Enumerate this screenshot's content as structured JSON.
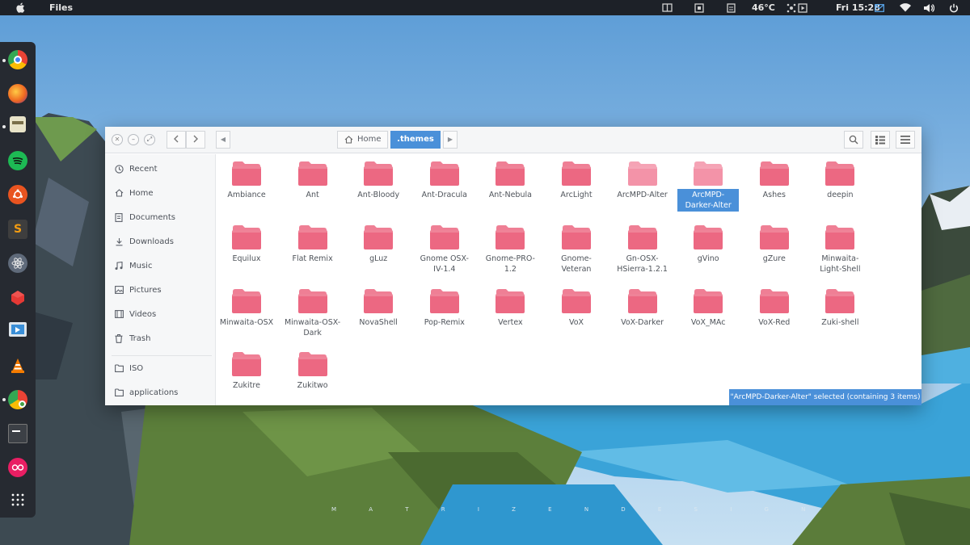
{
  "topbar": {
    "app_menu": "Files",
    "temperature": "46°C",
    "clock": "Fri 15:28"
  },
  "dock": {
    "items": [
      {
        "name": "chrome",
        "color": "#e9443a"
      },
      {
        "name": "firefox",
        "color": "#ef6a21"
      },
      {
        "name": "files",
        "color": "#e8e3c8"
      },
      {
        "name": "spotify",
        "color": "#1db954"
      },
      {
        "name": "ubuntu-software",
        "color": "#e95420"
      },
      {
        "name": "sublime-text",
        "color": "#f39c12"
      },
      {
        "name": "atom",
        "color": "#5f6a7a"
      },
      {
        "name": "ruby",
        "color": "#e53935"
      },
      {
        "name": "video-player",
        "color": "#3a8fd8"
      },
      {
        "name": "vlc",
        "color": "#f57c00"
      },
      {
        "name": "chrome-updater",
        "color": "#43a047"
      },
      {
        "name": "terminal",
        "color": "#3c4046"
      },
      {
        "name": "flickr",
        "color": "#e91e63"
      },
      {
        "name": "app-grid",
        "color": "#ffffff"
      }
    ]
  },
  "window": {
    "breadcrumb": {
      "home": "Home",
      "current": ".themes"
    },
    "sidebar": [
      {
        "label": "Recent",
        "icon": "clock-icon"
      },
      {
        "label": "Home",
        "icon": "home-icon"
      },
      {
        "label": "Documents",
        "icon": "document-icon"
      },
      {
        "label": "Downloads",
        "icon": "download-icon"
      },
      {
        "label": "Music",
        "icon": "music-icon"
      },
      {
        "label": "Pictures",
        "icon": "picture-icon"
      },
      {
        "label": "Videos",
        "icon": "video-icon"
      },
      {
        "label": "Trash",
        "icon": "trash-icon"
      },
      {
        "label": "ISO",
        "icon": "folder-icon"
      },
      {
        "label": "applications",
        "icon": "folder-icon"
      }
    ],
    "files": [
      "Ambiance",
      "Ant",
      "Ant-Bloody",
      "Ant-Dracula",
      "Ant-Nebula",
      "ArcLight",
      "ArcMPD-Alter",
      "ArcMPD-Darker-Alter",
      "Ashes",
      "deepin",
      "Equilux",
      "Flat Remix",
      "gLuz",
      "Gnome OSX-IV-1.4",
      "Gnome-PRO-1.2",
      "Gnome-Veteran",
      "Gn-OSX-HSierra-1.2.1",
      "gVino",
      "gZure",
      "Minwaita-Light-Shell",
      "Minwaita-OSX",
      "Minwaita-OSX-Dark",
      "NovaShell",
      "Pop-Remix",
      "Vertex",
      "VoX",
      "VoX-Darker",
      "VoX_MAc",
      "VoX-Red",
      "Zuki-shell",
      "Zukitre",
      "Zukitwo"
    ],
    "selected_file": "ArcMPD-Darker-Alter",
    "status": "\"ArcMPD-Darker-Alter\" selected  (containing 3 items)"
  },
  "colors": {
    "folder": "#ec6882",
    "folder_light": "#f393a8",
    "accent": "#4a90d9"
  },
  "wallpaper_text": "M A T R I Z E N   D E S I G N"
}
